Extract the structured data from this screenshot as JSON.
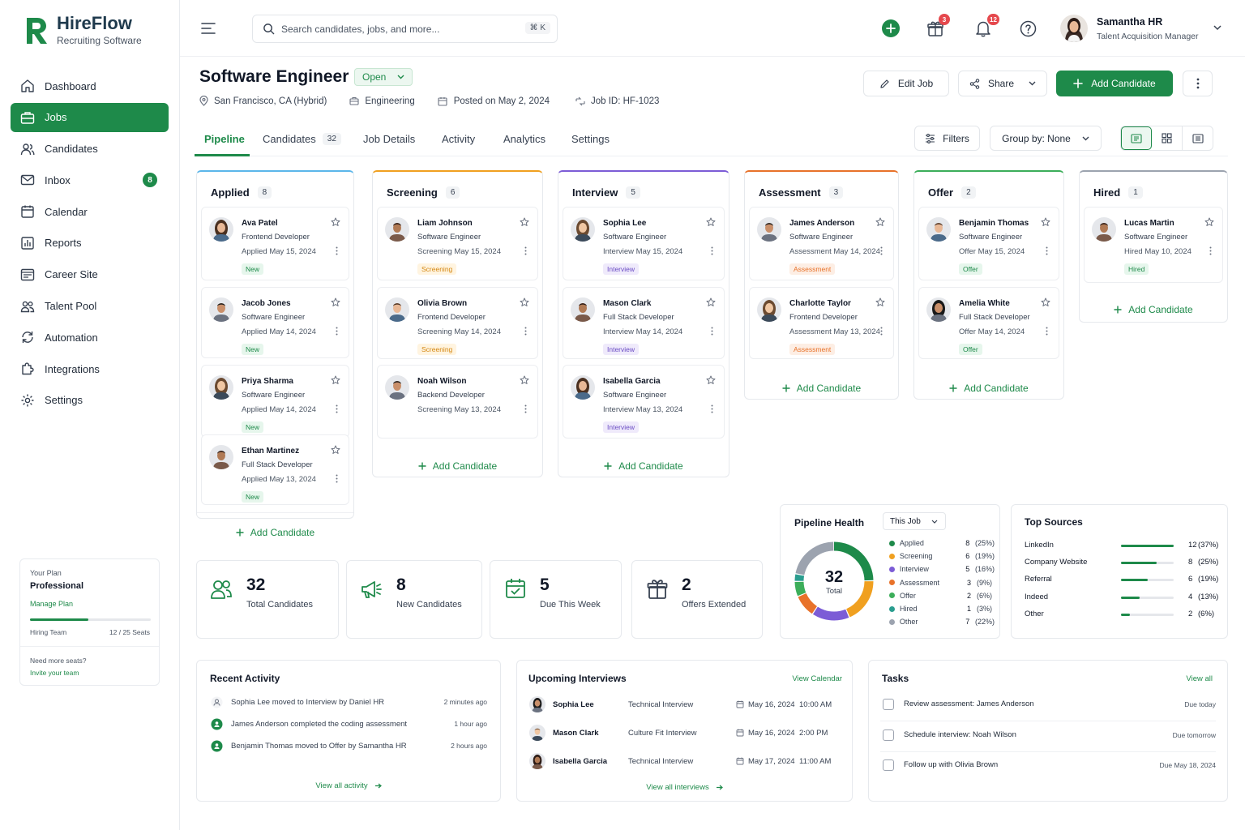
{
  "app": {
    "name": "HireFlow",
    "tagline": "Recruiting Software"
  },
  "colors": {
    "brand": "#1e8a4a",
    "applied": "#1e8a4a",
    "screening": "#f0a020",
    "interview": "#7c5cd6",
    "assessment": "#e8722a",
    "offer": "#3cae5a",
    "hired": "#1e8a4a",
    "other": "#9ca3af"
  },
  "sidebar": {
    "items": [
      {
        "label": "Dashboard",
        "icon": "home-icon"
      },
      {
        "label": "Jobs",
        "icon": "briefcase-icon",
        "active": true
      },
      {
        "label": "Candidates",
        "icon": "users-icon"
      },
      {
        "label": "Inbox",
        "icon": "mail-icon",
        "badge": "8"
      },
      {
        "label": "Calendar",
        "icon": "calendar-icon"
      },
      {
        "label": "Reports",
        "icon": "chart-icon"
      },
      {
        "label": "Career Site",
        "icon": "browser-icon"
      },
      {
        "label": "Talent Pool",
        "icon": "group-icon"
      },
      {
        "label": "Automation",
        "icon": "automation-icon"
      },
      {
        "label": "Integrations",
        "icon": "puzzle-icon"
      },
      {
        "label": "Settings",
        "icon": "gear-icon"
      }
    ],
    "plan": {
      "caption": "Your Plan",
      "name": "Professional",
      "manage": "Manage Plan",
      "team_label": "Hiring Team",
      "seats": "12 / 25 Seats",
      "seats_fraction": 0.48,
      "more_seats": "Need more seats?",
      "invite": "Invite your team"
    }
  },
  "topbar": {
    "search_placeholder": "Search candidates, jobs, and more...",
    "shortcut": "⌘ K",
    "gift_badge": "3",
    "notif_badge": "12",
    "user_name": "Samantha HR",
    "user_role": "Talent Acquisition Manager"
  },
  "job": {
    "title": "Software Engineer",
    "status": "Open",
    "location": "San Francisco, CA (Hybrid)",
    "department": "Engineering",
    "posted": "Posted on May 2, 2024",
    "job_id": "Job ID: HF-1023",
    "edit": "Edit Job",
    "share": "Share",
    "add": "Add Candidate"
  },
  "tabs": [
    {
      "label": "Pipeline",
      "active": true
    },
    {
      "label": "Candidates",
      "count": "32"
    },
    {
      "label": "Job Details"
    },
    {
      "label": "Activity"
    },
    {
      "label": "Analytics"
    },
    {
      "label": "Settings"
    }
  ],
  "toolbar": {
    "filters": "Filters",
    "group_by": "Group by: None"
  },
  "add_candidate_label": "Add Candidate",
  "columns": [
    {
      "name": "Applied",
      "count": "8",
      "candidates": [
        {
          "name": "Ava Patel",
          "role": "Frontend Developer",
          "date": "Applied May 15, 2024",
          "tag": "New",
          "gender": "f"
        },
        {
          "name": "Jacob Jones",
          "role": "Software Engineer",
          "date": "Applied May 14, 2024",
          "tag": "New",
          "gender": "m"
        },
        {
          "name": "Priya Sharma",
          "role": "Software Engineer",
          "date": "Applied May 14, 2024",
          "tag": "New",
          "gender": "f"
        },
        {
          "name": "Ethan Martinez",
          "role": "Full Stack Developer",
          "date": "Applied May 13, 2024",
          "tag": "New",
          "gender": "m"
        }
      ]
    },
    {
      "name": "Screening",
      "count": "6",
      "candidates": [
        {
          "name": "Liam Johnson",
          "role": "Software Engineer",
          "date": "Screening May 15, 2024",
          "tag": "Screening",
          "gender": "m"
        },
        {
          "name": "Olivia Brown",
          "role": "Frontend Developer",
          "date": "Screening May 14, 2024",
          "tag": "Screening",
          "gender": "m"
        },
        {
          "name": "Noah Wilson",
          "role": "Backend Developer",
          "date": "Screening May 13, 2024",
          "tag": "",
          "gender": "m"
        }
      ]
    },
    {
      "name": "Interview",
      "count": "5",
      "candidates": [
        {
          "name": "Sophia Lee",
          "role": "Software Engineer",
          "date": "Interview May 15, 2024",
          "tag": "Interview",
          "gender": "f"
        },
        {
          "name": "Mason Clark",
          "role": "Full Stack Developer",
          "date": "Interview May 14, 2024",
          "tag": "Interview",
          "gender": "m"
        },
        {
          "name": "Isabella Garcia",
          "role": "Software Engineer",
          "date": "Interview May 13, 2024",
          "tag": "Interview",
          "gender": "f"
        }
      ]
    },
    {
      "name": "Assessment",
      "count": "3",
      "candidates": [
        {
          "name": "James Anderson",
          "role": "Software Engineer",
          "date": "Assessment May 14, 2024",
          "tag": "Assessment",
          "gender": "m"
        },
        {
          "name": "Charlotte Taylor",
          "role": "Frontend Developer",
          "date": "Assessment May 13, 2024",
          "tag": "Assessment",
          "gender": "f"
        }
      ]
    },
    {
      "name": "Offer",
      "count": "2",
      "candidates": [
        {
          "name": "Benjamin Thomas",
          "role": "Software Engineer",
          "date": "Offer May 15, 2024",
          "tag": "Offer",
          "gender": "m"
        },
        {
          "name": "Amelia White",
          "role": "Full Stack Developer",
          "date": "Offer May 14, 2024",
          "tag": "Offer",
          "gender": "f"
        }
      ]
    },
    {
      "name": "Hired",
      "count": "1",
      "candidates": [
        {
          "name": "Lucas Martin",
          "role": "Software Engineer",
          "date": "Hired May 10, 2024",
          "tag": "Hired",
          "gender": "m"
        }
      ]
    }
  ],
  "stats": [
    {
      "value": "32",
      "label": "Total Candidates",
      "icon": "users-icon"
    },
    {
      "value": "8",
      "label": "New Candidates",
      "icon": "megaphone-icon"
    },
    {
      "value": "5",
      "label": "Due This Week",
      "icon": "calendar-check-icon"
    },
    {
      "value": "2",
      "label": "Offers Extended",
      "icon": "gift-icon"
    }
  ],
  "pipeline_health": {
    "title": "Pipeline Health",
    "scope": "This Job",
    "total": "32",
    "total_label": "Total",
    "legend": [
      {
        "label": "Applied",
        "value": "8",
        "pct": "(25%)",
        "n": 8,
        "color": "#1e8a4a"
      },
      {
        "label": "Screening",
        "value": "6",
        "pct": "(19%)",
        "n": 6,
        "color": "#f0a020"
      },
      {
        "label": "Interview",
        "value": "5",
        "pct": "(16%)",
        "n": 5,
        "color": "#7c5cd6"
      },
      {
        "label": "Assessment",
        "value": "3",
        "pct": "(9%)",
        "n": 3,
        "color": "#e8722a"
      },
      {
        "label": "Offer",
        "value": "2",
        "pct": "(6%)",
        "n": 2,
        "color": "#3cae5a"
      },
      {
        "label": "Hired",
        "value": "1",
        "pct": "(3%)",
        "n": 1,
        "color": "#2a9d8f"
      },
      {
        "label": "Other",
        "value": "7",
        "pct": "(22%)",
        "n": 7,
        "color": "#9ca3af"
      }
    ]
  },
  "top_sources": {
    "title": "Top Sources",
    "items": [
      {
        "name": "LinkedIn",
        "value": "12",
        "pct": "(37%)",
        "frac": 0.37
      },
      {
        "name": "Company Website",
        "value": "8",
        "pct": "(25%)",
        "frac": 0.25
      },
      {
        "name": "Referral",
        "value": "6",
        "pct": "(19%)",
        "frac": 0.19
      },
      {
        "name": "Indeed",
        "value": "4",
        "pct": "(13%)",
        "frac": 0.13
      },
      {
        "name": "Other",
        "value": "2",
        "pct": "(6%)",
        "frac": 0.06
      }
    ]
  },
  "recent_activity": {
    "title": "Recent Activity",
    "items": [
      {
        "text": "Sophia Lee moved to Interview by Daniel HR",
        "time": "2 minutes ago"
      },
      {
        "text": "James Anderson completed the coding assessment",
        "time": "1 hour ago"
      },
      {
        "text": "Benjamin Thomas moved to Offer by Samantha HR",
        "time": "2 hours ago"
      }
    ],
    "view_all": "View all activity"
  },
  "upcoming": {
    "title": "Upcoming Interviews",
    "view_calendar": "View Calendar",
    "items": [
      {
        "name": "Sophia Lee",
        "type": "Technical Interview",
        "date": "May 16, 2024",
        "time": "10:00 AM",
        "gender": "f"
      },
      {
        "name": "Mason Clark",
        "type": "Culture Fit Interview",
        "date": "May 16, 2024",
        "time": "2:00 PM",
        "gender": "m"
      },
      {
        "name": "Isabella Garcia",
        "type": "Technical Interview",
        "date": "May 17, 2024",
        "time": "11:00 AM",
        "gender": "f"
      }
    ],
    "view_all": "View all interviews"
  },
  "tasks": {
    "title": "Tasks",
    "view_all": "View all",
    "items": [
      {
        "text": "Review assessment: James Anderson",
        "due": "Due today"
      },
      {
        "text": "Schedule interview: Noah Wilson",
        "due": "Due tomorrow"
      },
      {
        "text": "Follow up with Olivia Brown",
        "due": "Due May 18, 2024"
      }
    ]
  }
}
